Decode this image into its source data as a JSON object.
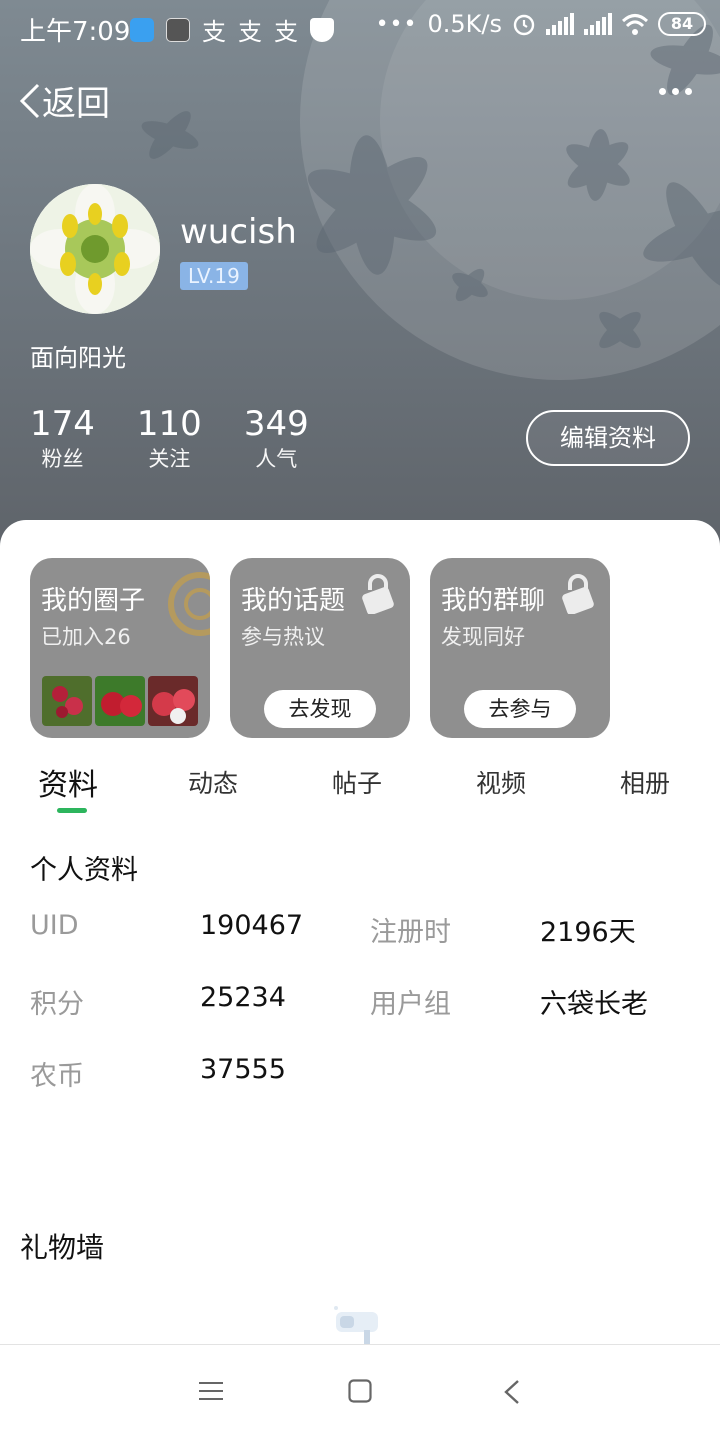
{
  "status_bar": {
    "time": "上午7:09",
    "network_speed": "0.5K/s",
    "battery": "84",
    "app_icons": [
      "blue-app-icon",
      "mi-app-icon",
      "alipay-icon",
      "alipay-icon",
      "alipay-icon",
      "security-shield-icon"
    ]
  },
  "nav": {
    "back_label": "返回",
    "more_icon": "more-dots-icon"
  },
  "profile": {
    "username": "wucish",
    "level": "LV.19",
    "signature": "面向阳光",
    "stats": [
      {
        "num": "174",
        "label": "粉丝"
      },
      {
        "num": "110",
        "label": "关注"
      },
      {
        "num": "349",
        "label": "人气"
      }
    ],
    "edit_button": "编辑资料"
  },
  "cards": [
    {
      "title": "我的圈子",
      "sub": "已加入26"
    },
    {
      "title": "我的话题",
      "sub": "参与热议",
      "button": "去发现"
    },
    {
      "title": "我的群聊",
      "sub": "发现同好",
      "button": "去参与"
    }
  ],
  "tabs": [
    "资料",
    "动态",
    "帖子",
    "视频",
    "相册"
  ],
  "active_tab": "资料",
  "info": {
    "title": "个人资料",
    "uid_k": "UID",
    "uid_v": "190467",
    "reg_k": "注册时",
    "reg_v": "2196天",
    "points_k": "积分",
    "points_v": "25234",
    "group_k": "用户组",
    "group_v": "六袋长老",
    "coin_k": "农币",
    "coin_v": "37555"
  },
  "gift_wall": {
    "title": "礼物墙"
  },
  "colors": {
    "accent_green": "#2db55d",
    "card_gray": "#8f8f8f",
    "level_badge": "#8ab4e6"
  }
}
